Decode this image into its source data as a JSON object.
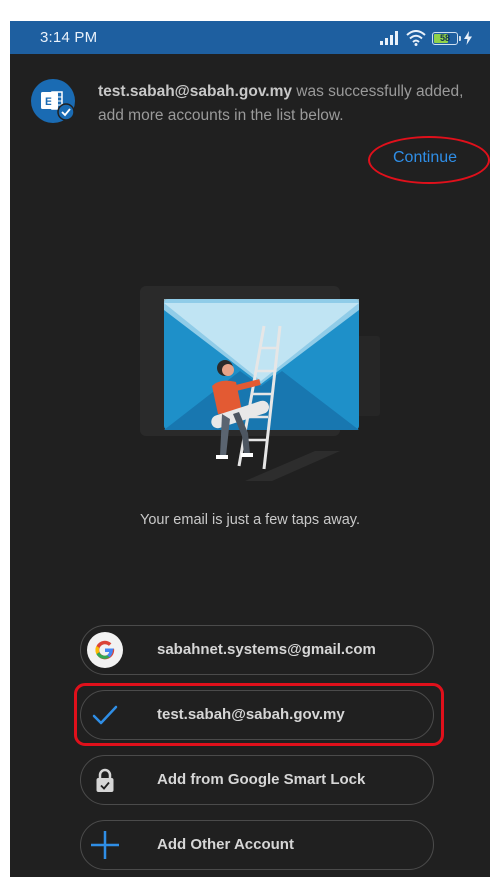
{
  "status_bar": {
    "time": "3:14 PM",
    "battery_level": "58",
    "icons": [
      "signal-icon",
      "wifi-icon",
      "battery-icon",
      "charging-icon"
    ]
  },
  "notice": {
    "account_email": "test.sabah@sabah.gov.my",
    "message": " was successfully added, add more accounts in the list below.",
    "continue_label": "Continue"
  },
  "illustration": {
    "tagline": "Your email is just a few taps away."
  },
  "accounts": [
    {
      "label": "sabahnet.systems@gmail.com",
      "icon": "google-icon"
    },
    {
      "label": "test.sabah@sabah.gov.my",
      "icon": "checkmark-icon",
      "selected": true
    },
    {
      "label": "Add from Google Smart Lock",
      "icon": "lock-icon"
    },
    {
      "label": "Add Other Account",
      "icon": "plus-icon"
    }
  ],
  "colors": {
    "status_bar": "#1e5fa0",
    "background": "#202020",
    "accent": "#2f8ee6",
    "annotation": "#e0101b"
  }
}
